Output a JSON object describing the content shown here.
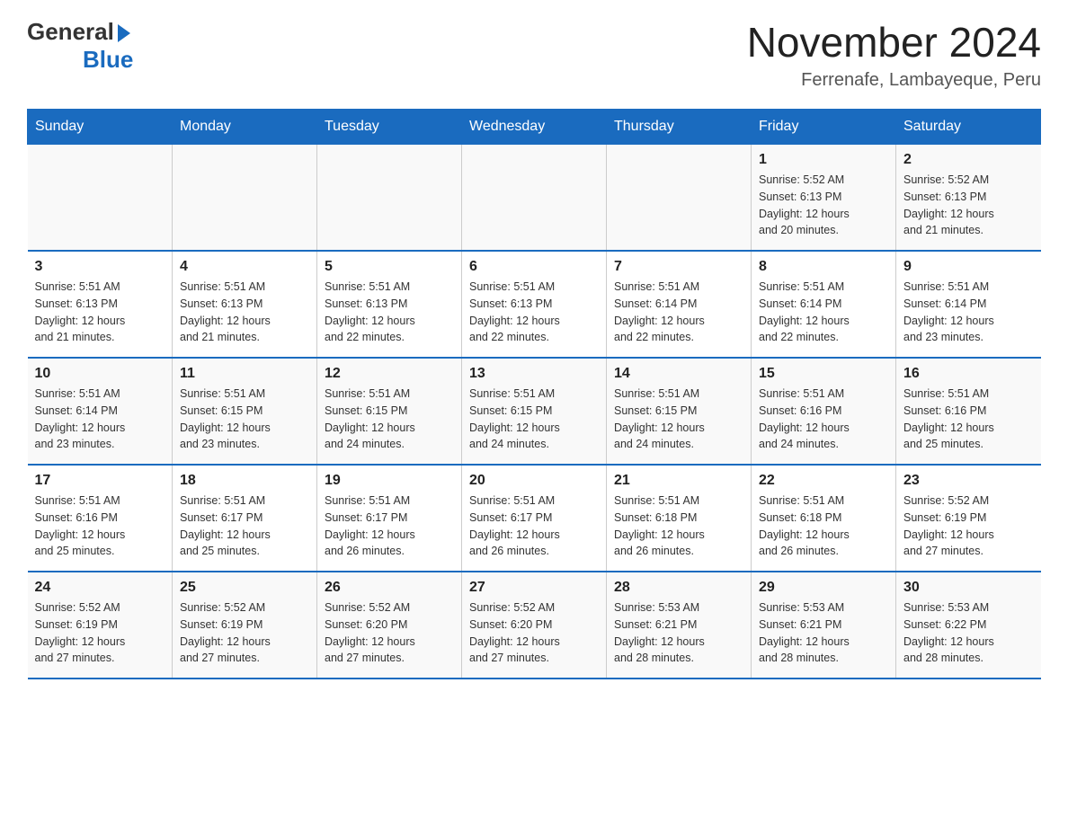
{
  "header": {
    "logo_general": "General",
    "logo_blue": "Blue",
    "title": "November 2024",
    "subtitle": "Ferrenafe, Lambayeque, Peru"
  },
  "days_of_week": [
    "Sunday",
    "Monday",
    "Tuesday",
    "Wednesday",
    "Thursday",
    "Friday",
    "Saturday"
  ],
  "weeks": [
    [
      {
        "day": "",
        "info": ""
      },
      {
        "day": "",
        "info": ""
      },
      {
        "day": "",
        "info": ""
      },
      {
        "day": "",
        "info": ""
      },
      {
        "day": "",
        "info": ""
      },
      {
        "day": "1",
        "info": "Sunrise: 5:52 AM\nSunset: 6:13 PM\nDaylight: 12 hours\nand 20 minutes."
      },
      {
        "day": "2",
        "info": "Sunrise: 5:52 AM\nSunset: 6:13 PM\nDaylight: 12 hours\nand 21 minutes."
      }
    ],
    [
      {
        "day": "3",
        "info": "Sunrise: 5:51 AM\nSunset: 6:13 PM\nDaylight: 12 hours\nand 21 minutes."
      },
      {
        "day": "4",
        "info": "Sunrise: 5:51 AM\nSunset: 6:13 PM\nDaylight: 12 hours\nand 21 minutes."
      },
      {
        "day": "5",
        "info": "Sunrise: 5:51 AM\nSunset: 6:13 PM\nDaylight: 12 hours\nand 22 minutes."
      },
      {
        "day": "6",
        "info": "Sunrise: 5:51 AM\nSunset: 6:13 PM\nDaylight: 12 hours\nand 22 minutes."
      },
      {
        "day": "7",
        "info": "Sunrise: 5:51 AM\nSunset: 6:14 PM\nDaylight: 12 hours\nand 22 minutes."
      },
      {
        "day": "8",
        "info": "Sunrise: 5:51 AM\nSunset: 6:14 PM\nDaylight: 12 hours\nand 22 minutes."
      },
      {
        "day": "9",
        "info": "Sunrise: 5:51 AM\nSunset: 6:14 PM\nDaylight: 12 hours\nand 23 minutes."
      }
    ],
    [
      {
        "day": "10",
        "info": "Sunrise: 5:51 AM\nSunset: 6:14 PM\nDaylight: 12 hours\nand 23 minutes."
      },
      {
        "day": "11",
        "info": "Sunrise: 5:51 AM\nSunset: 6:15 PM\nDaylight: 12 hours\nand 23 minutes."
      },
      {
        "day": "12",
        "info": "Sunrise: 5:51 AM\nSunset: 6:15 PM\nDaylight: 12 hours\nand 24 minutes."
      },
      {
        "day": "13",
        "info": "Sunrise: 5:51 AM\nSunset: 6:15 PM\nDaylight: 12 hours\nand 24 minutes."
      },
      {
        "day": "14",
        "info": "Sunrise: 5:51 AM\nSunset: 6:15 PM\nDaylight: 12 hours\nand 24 minutes."
      },
      {
        "day": "15",
        "info": "Sunrise: 5:51 AM\nSunset: 6:16 PM\nDaylight: 12 hours\nand 24 minutes."
      },
      {
        "day": "16",
        "info": "Sunrise: 5:51 AM\nSunset: 6:16 PM\nDaylight: 12 hours\nand 25 minutes."
      }
    ],
    [
      {
        "day": "17",
        "info": "Sunrise: 5:51 AM\nSunset: 6:16 PM\nDaylight: 12 hours\nand 25 minutes."
      },
      {
        "day": "18",
        "info": "Sunrise: 5:51 AM\nSunset: 6:17 PM\nDaylight: 12 hours\nand 25 minutes."
      },
      {
        "day": "19",
        "info": "Sunrise: 5:51 AM\nSunset: 6:17 PM\nDaylight: 12 hours\nand 26 minutes."
      },
      {
        "day": "20",
        "info": "Sunrise: 5:51 AM\nSunset: 6:17 PM\nDaylight: 12 hours\nand 26 minutes."
      },
      {
        "day": "21",
        "info": "Sunrise: 5:51 AM\nSunset: 6:18 PM\nDaylight: 12 hours\nand 26 minutes."
      },
      {
        "day": "22",
        "info": "Sunrise: 5:51 AM\nSunset: 6:18 PM\nDaylight: 12 hours\nand 26 minutes."
      },
      {
        "day": "23",
        "info": "Sunrise: 5:52 AM\nSunset: 6:19 PM\nDaylight: 12 hours\nand 27 minutes."
      }
    ],
    [
      {
        "day": "24",
        "info": "Sunrise: 5:52 AM\nSunset: 6:19 PM\nDaylight: 12 hours\nand 27 minutes."
      },
      {
        "day": "25",
        "info": "Sunrise: 5:52 AM\nSunset: 6:19 PM\nDaylight: 12 hours\nand 27 minutes."
      },
      {
        "day": "26",
        "info": "Sunrise: 5:52 AM\nSunset: 6:20 PM\nDaylight: 12 hours\nand 27 minutes."
      },
      {
        "day": "27",
        "info": "Sunrise: 5:52 AM\nSunset: 6:20 PM\nDaylight: 12 hours\nand 27 minutes."
      },
      {
        "day": "28",
        "info": "Sunrise: 5:53 AM\nSunset: 6:21 PM\nDaylight: 12 hours\nand 28 minutes."
      },
      {
        "day": "29",
        "info": "Sunrise: 5:53 AM\nSunset: 6:21 PM\nDaylight: 12 hours\nand 28 minutes."
      },
      {
        "day": "30",
        "info": "Sunrise: 5:53 AM\nSunset: 6:22 PM\nDaylight: 12 hours\nand 28 minutes."
      }
    ]
  ]
}
